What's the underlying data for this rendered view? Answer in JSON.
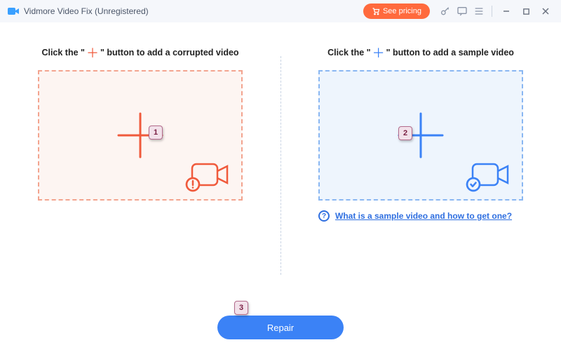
{
  "titlebar": {
    "title": "Vidmore Video Fix (Unregistered)",
    "pricing_label": "See pricing"
  },
  "left": {
    "instruct_pre": "Click the \"",
    "instruct_post": "\" button to add a corrupted video"
  },
  "right": {
    "instruct_pre": "Click the \"",
    "instruct_post": "\" button to add a sample video",
    "help_link": "What is a sample video and how to get one?"
  },
  "actions": {
    "repair_label": "Repair"
  },
  "callouts": {
    "one": "1",
    "two": "2",
    "three": "3"
  },
  "colors": {
    "accent_blue": "#3b82f6",
    "accent_orange": "#ff6a3d",
    "corrupted": "#f05a3c",
    "sample": "#3b82f6"
  }
}
